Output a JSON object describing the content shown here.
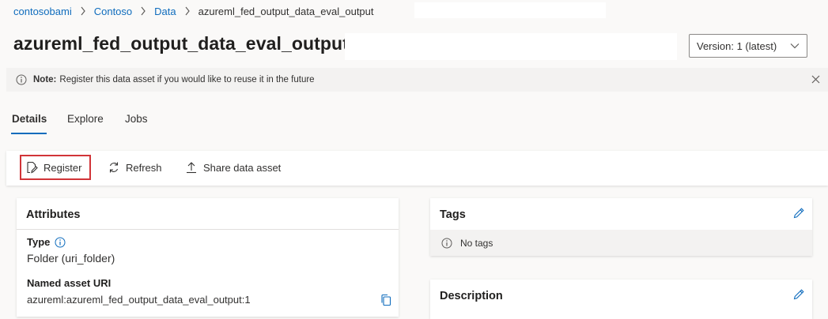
{
  "breadcrumb": {
    "items": [
      "contosobami",
      "Contoso",
      "Data"
    ],
    "current": "azureml_fed_output_data_eval_output"
  },
  "header": {
    "title": "azureml_fed_output_data_eval_output",
    "version_label": "Version: 1 (latest)"
  },
  "note": {
    "label": "Note:",
    "text": "Register this data asset if you would like to reuse it in the future"
  },
  "tabs": [
    {
      "label": "Details",
      "active": true
    },
    {
      "label": "Explore",
      "active": false
    },
    {
      "label": "Jobs",
      "active": false
    }
  ],
  "toolbar": {
    "register_label": "Register",
    "refresh_label": "Refresh",
    "share_label": "Share data asset"
  },
  "attributes": {
    "title": "Attributes",
    "type_label": "Type",
    "type_value": "Folder (uri_folder)",
    "uri_label": "Named asset URI",
    "uri_value": "azureml:azureml_fed_output_data_eval_output:1"
  },
  "tags": {
    "title": "Tags",
    "empty_text": "No tags"
  },
  "description": {
    "title": "Description"
  },
  "colors": {
    "accent": "#0f6cbd",
    "highlight": "#d13438"
  }
}
